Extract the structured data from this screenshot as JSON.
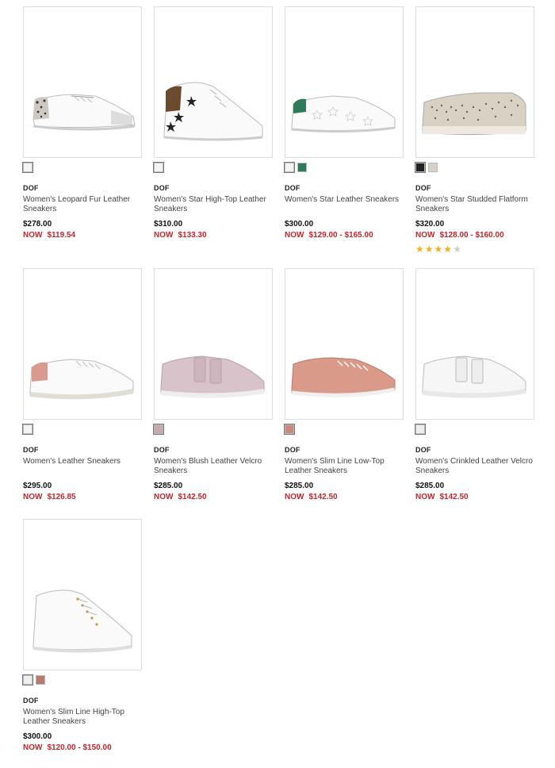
{
  "products": [
    {
      "brand": "DOF",
      "name": "Women's Leopard Fur Leather Sneakers",
      "price": "$278.00",
      "now_label": "NOW",
      "sale": "$119.54",
      "swatches": [
        "#f4f4f4"
      ],
      "variant": "leopard"
    },
    {
      "brand": "DOF",
      "name": "Women's Star High-Top Leather Sneakers",
      "price": "$310.00",
      "now_label": "NOW",
      "sale": "$133.30",
      "swatches": [
        "#f4f4f4"
      ],
      "variant": "star-high"
    },
    {
      "brand": "DOF",
      "name": "Women's Star Leather Sneakers",
      "price": "$300.00",
      "now_label": "NOW",
      "sale": "$129.00 - $165.00",
      "swatches": [
        "#f4f4f4",
        "#2f7a5a"
      ],
      "variant": "star-low"
    },
    {
      "brand": "DOF",
      "name": "Women's Star Studded Flatform Sneakers",
      "price": "$320.00",
      "now_label": "NOW",
      "sale": "$128.00 - $160.00",
      "swatches": [
        "#222222",
        "#d9d2c4"
      ],
      "variant": "studded",
      "rating": 4
    },
    {
      "brand": "DOF",
      "name": "Women's Leather Sneakers",
      "price": "$295.00",
      "now_label": "NOW",
      "sale": "$126.85",
      "swatches": [
        "#f4f4f4"
      ],
      "variant": "leather"
    },
    {
      "brand": "DOF",
      "name": "Women's Blush Leather Velcro Sneakers",
      "price": "$285.00",
      "now_label": "NOW",
      "sale": "$142.50",
      "swatches": [
        "#c9a9b0"
      ],
      "variant": "blush"
    },
    {
      "brand": "DOF",
      "name": "Women's Slim Line Low-Top Leather Sneakers",
      "price": "$285.00",
      "now_label": "NOW",
      "sale": "$142.50",
      "swatches": [
        "#c98a7c"
      ],
      "variant": "slim-low"
    },
    {
      "brand": "DOF",
      "name": "Women's Crinkled Leather Velcro Sneakers",
      "price": "$285.00",
      "now_label": "NOW",
      "sale": "$142.50",
      "swatches": [
        "#eeeeee"
      ],
      "variant": "crinkled"
    },
    {
      "brand": "DOF",
      "name": "Women's Slim Line High-Top Leather Sneakers",
      "price": "$300.00",
      "now_label": "NOW",
      "sale": "$120.00 - $150.00",
      "swatches": [
        "#eeeeee",
        "#b77a6c"
      ],
      "variant": "slim-high"
    }
  ]
}
